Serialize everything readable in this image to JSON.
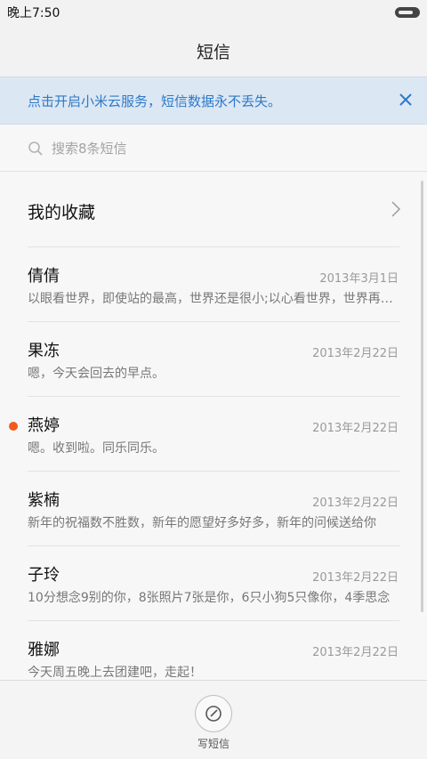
{
  "status": {
    "time": "晚上7:50",
    "battery_level": 0.8
  },
  "header": {
    "title": "短信"
  },
  "banner": {
    "text": "点击开启小米云服务，短信数据永不丢失。",
    "close_icon": "close-icon",
    "accent": "#2e79c7"
  },
  "search": {
    "placeholder": "搜索8条短信",
    "icon": "search-icon"
  },
  "favorites": {
    "label": "我的收藏",
    "icon": "chevron-right-icon"
  },
  "messages": [
    {
      "name": "倩倩",
      "date": "2013年3月1日",
      "preview": "以眼看世界，即使站的最高，世界还是很小;以心看世界，世界再小，也是大的",
      "unread": false
    },
    {
      "name": "果冻",
      "date": "2013年2月22日",
      "preview": "嗯，今天会回去的早点。",
      "unread": false
    },
    {
      "name": "燕婷",
      "date": "2013年2月22日",
      "preview": "嗯。收到啦。同乐同乐。",
      "unread": true
    },
    {
      "name": "紫楠",
      "date": "2013年2月22日",
      "preview": "新年的祝福数不胜数，新年的愿望好多好多，新年的问候送给你",
      "unread": false
    },
    {
      "name": "子玲",
      "date": "2013年2月22日",
      "preview": "10分想念9别的你，8张照片7张是你，6只小狗5只像你，4季思念",
      "unread": false
    },
    {
      "name": "雅娜",
      "date": "2013年2月22日",
      "preview": "今天周五晚上去团建吧，走起！",
      "unread": false
    }
  ],
  "colors": {
    "unread_dot": "#f05a1e"
  },
  "compose": {
    "label": "写短信",
    "icon": "compose-icon"
  }
}
